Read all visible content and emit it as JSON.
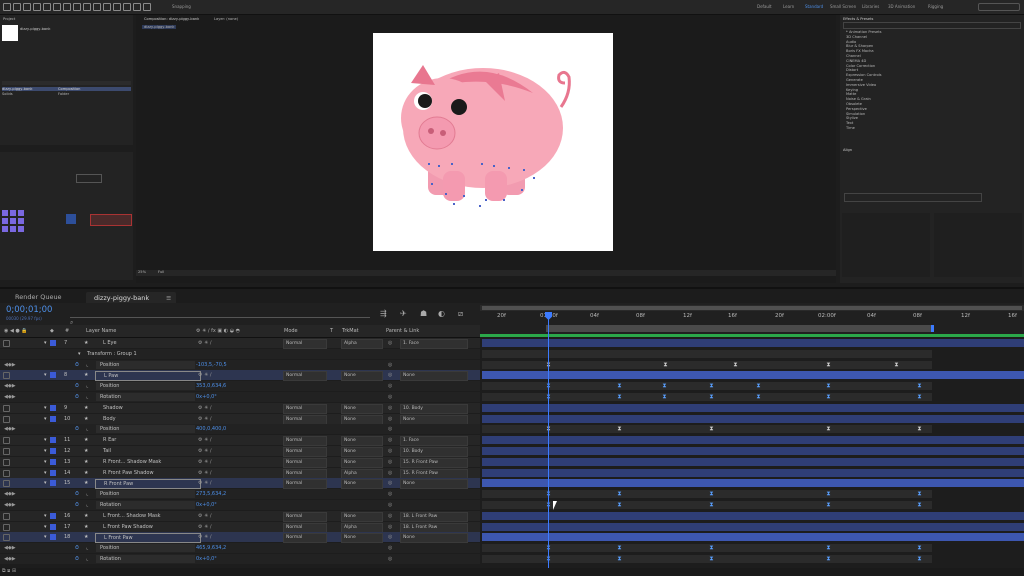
{
  "toolbar": {
    "snapping_label": "Snapping",
    "workspaces": [
      "Default",
      "Learn",
      "Standard",
      "Small Screen",
      "Libraries",
      "3D Animation",
      "Rigging"
    ],
    "active_workspace": "Standard"
  },
  "project_panel": {
    "tab": "Project",
    "items": [
      {
        "name": "dizzy-piggy-bank",
        "type": "Composition"
      },
      {
        "name": "Solids",
        "type": "Folder"
      }
    ]
  },
  "composition_viewer": {
    "tab": "Composition: dizzy-piggy-bank",
    "crumb": "dizzy-piggy-bank",
    "layer_tab": "Layer: (none)",
    "zoom": "25%",
    "quality": "Full"
  },
  "effects_panel": {
    "title": "Effects & Presets",
    "items": [
      "* Animation Presets",
      "3D Channel",
      "Audio",
      "Blur & Sharpen",
      "Boris FX Mocha",
      "Channel",
      "CINEMA 4D",
      "Color Correction",
      "Distort",
      "Expression Controls",
      "Generate",
      "Immersive Video",
      "Keying",
      "Matte",
      "Noise & Grain",
      "Obsolete",
      "Perspective",
      "Simulation",
      "Stylize",
      "Text",
      "Time"
    ]
  },
  "align_panel": {
    "title": "Align"
  },
  "timeline": {
    "tab_render": "Render Queue",
    "tab_comp": "dizzy-piggy-bank",
    "timecode": "0;00;01;00",
    "timecode_sub": "00030 (29.97 fps)",
    "columns": {
      "layer_name": "Layer Name",
      "mode": "Mode",
      "t": "T",
      "trkmat": "TrkMat",
      "parent": "Parent & Link"
    },
    "ruler": [
      "20f",
      "01:00f",
      "04f",
      "08f",
      "12f",
      "16f",
      "20f",
      "02:00f",
      "04f",
      "08f",
      "12f",
      "16f"
    ],
    "rows": [
      {
        "kind": "layer",
        "num": "7",
        "name": "L Eye",
        "mode": "Normal",
        "trkmat": "Alpha",
        "parent": "1. Face",
        "color": "#3b5bd8"
      },
      {
        "kind": "group",
        "name": "Transform : Group 1"
      },
      {
        "kind": "prop",
        "name": "Position",
        "value": "-103,5,-70,5"
      },
      {
        "kind": "layer",
        "num": "8",
        "name": "L Paw",
        "mode": "Normal",
        "trkmat": "None",
        "parent": "None",
        "color": "#3b5bd8",
        "selected": true
      },
      {
        "kind": "prop",
        "name": "Position",
        "value": "353,0,634,6"
      },
      {
        "kind": "prop",
        "name": "Rotation",
        "value": "0x+0,0°"
      },
      {
        "kind": "layer",
        "num": "9",
        "name": "Shadow",
        "mode": "Normal",
        "trkmat": "None",
        "parent": "10. Body",
        "color": "#3b5bd8"
      },
      {
        "kind": "layer",
        "num": "10",
        "name": "Body",
        "mode": "Normal",
        "trkmat": "None",
        "parent": "None",
        "color": "#3b5bd8"
      },
      {
        "kind": "prop",
        "name": "Position",
        "value": "400,0,400,0"
      },
      {
        "kind": "layer",
        "num": "11",
        "name": "R Ear",
        "mode": "Normal",
        "trkmat": "None",
        "parent": "1. Face",
        "color": "#3b5bd8"
      },
      {
        "kind": "layer",
        "num": "12",
        "name": "Tail",
        "mode": "Normal",
        "trkmat": "None",
        "parent": "10. Body",
        "color": "#3b5bd8"
      },
      {
        "kind": "layer",
        "num": "13",
        "name": "R Front... Shadow Mask",
        "mode": "Normal",
        "trkmat": "None",
        "parent": "15. R Front Paw",
        "color": "#3b5bd8"
      },
      {
        "kind": "layer",
        "num": "14",
        "name": "R Front Paw Shadow",
        "mode": "Normal",
        "trkmat": "Alpha",
        "parent": "15. R Front Paw",
        "color": "#3b5bd8"
      },
      {
        "kind": "layer",
        "num": "15",
        "name": "R Front Paw",
        "mode": "Normal",
        "trkmat": "None",
        "parent": "None",
        "color": "#3b5bd8",
        "selected": true
      },
      {
        "kind": "prop",
        "name": "Position",
        "value": "273,5,634,2"
      },
      {
        "kind": "prop",
        "name": "Rotation",
        "value": "0x+0,0°"
      },
      {
        "kind": "layer",
        "num": "16",
        "name": "L Front... Shadow Mask",
        "mode": "Normal",
        "trkmat": "None",
        "parent": "18. L Front Paw",
        "color": "#3b5bd8"
      },
      {
        "kind": "layer",
        "num": "17",
        "name": "L Front Paw Shadow",
        "mode": "Normal",
        "trkmat": "Alpha",
        "parent": "18. L Front Paw",
        "color": "#3b5bd8"
      },
      {
        "kind": "layer",
        "num": "18",
        "name": "L Front Paw",
        "mode": "Normal",
        "trkmat": "None",
        "parent": "None",
        "color": "#3b5bd8",
        "selected": true
      },
      {
        "kind": "prop",
        "name": "Position",
        "value": "465,9,634,2"
      },
      {
        "kind": "prop",
        "name": "Rotation",
        "value": "0x+0,0°"
      }
    ]
  },
  "colors": {
    "accent": "#4d8fe8",
    "layer_bar": "#3d57b0",
    "pig_pink": "#f7a8b8",
    "pig_dark": "#e8768f"
  }
}
